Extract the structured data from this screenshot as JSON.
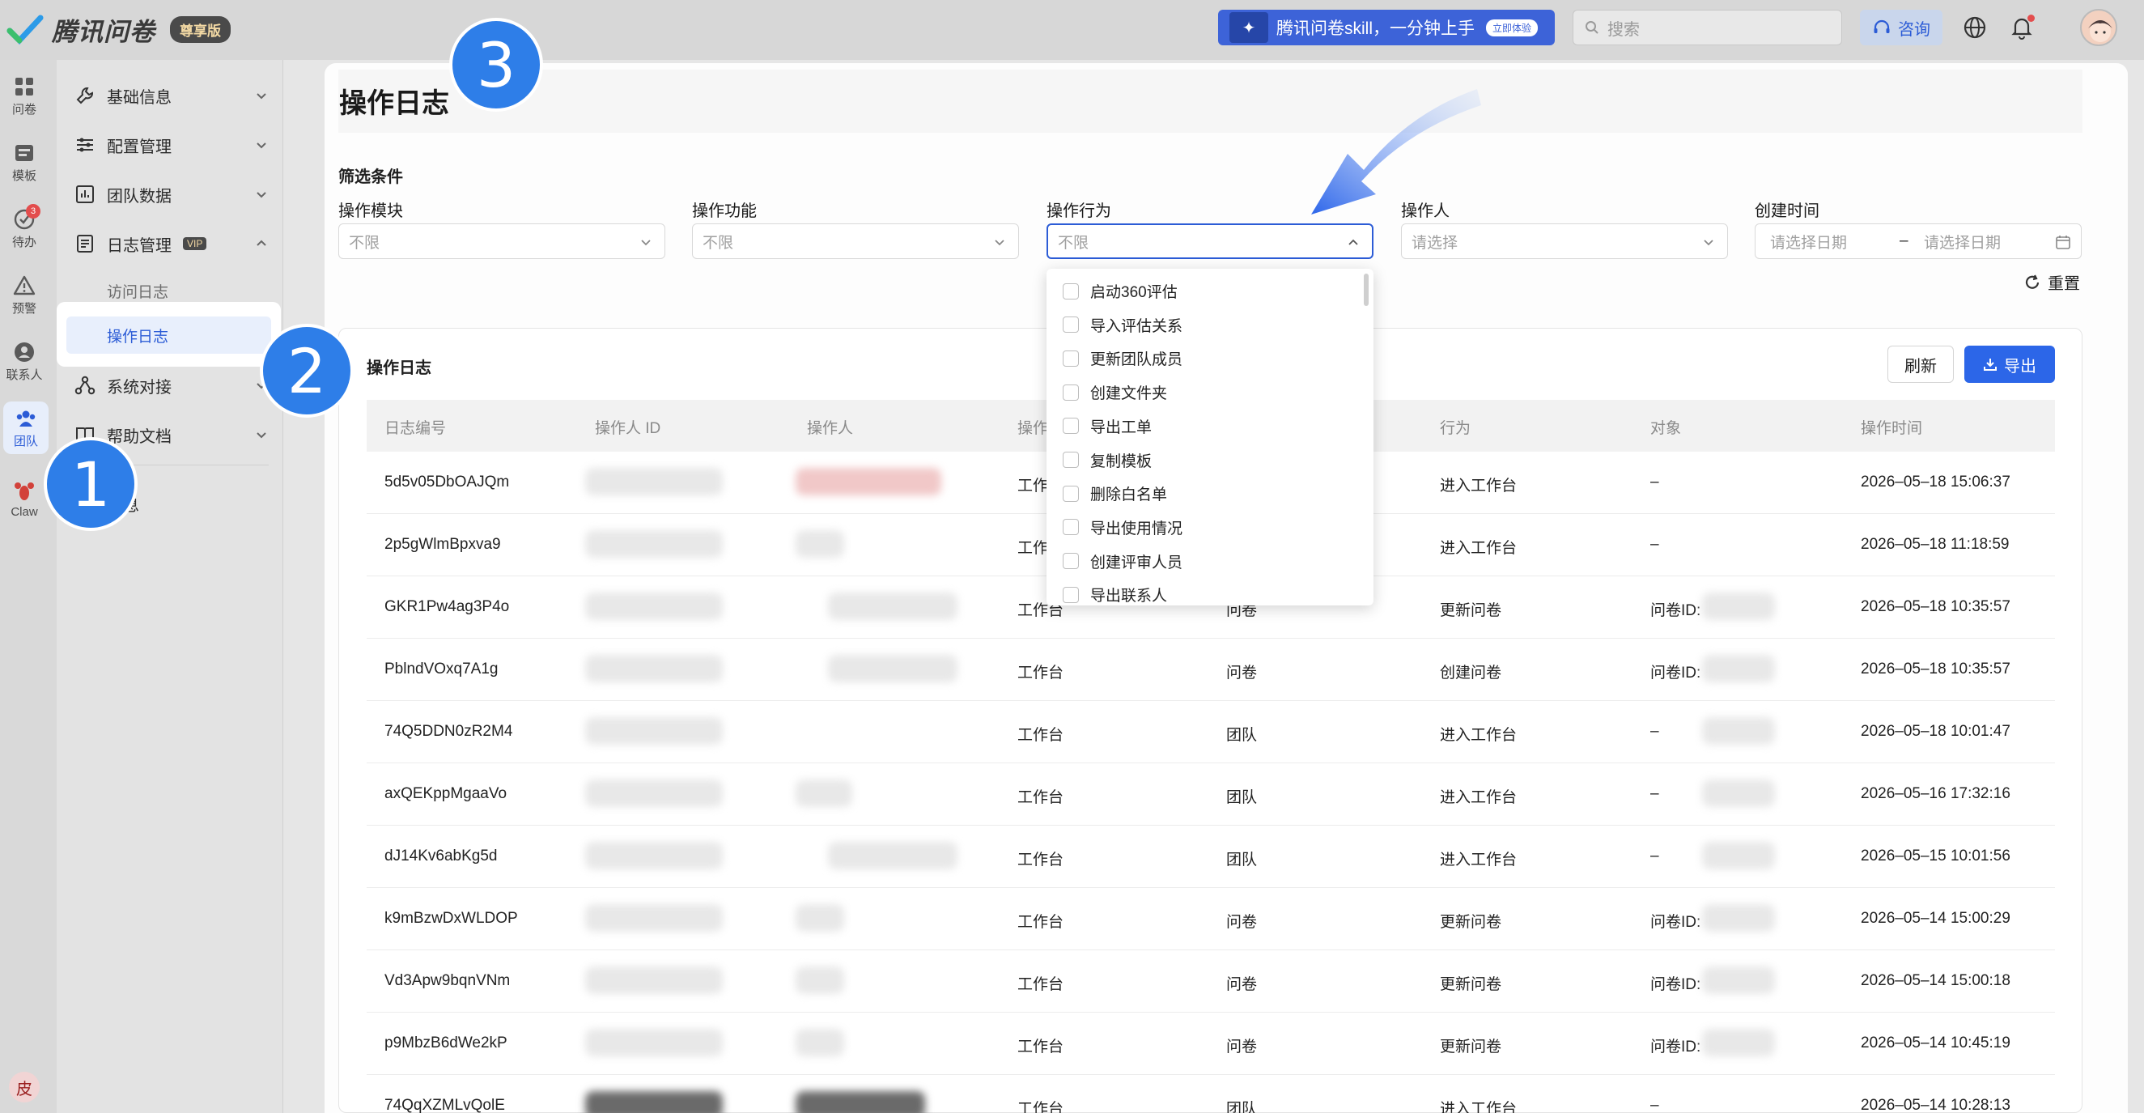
{
  "header": {
    "app_name": "腾讯问卷",
    "edition": "尊享版",
    "promo_text": "腾讯问卷skill，一分钟上手",
    "promo_chip": "立即体验",
    "search_placeholder": "搜索",
    "consult_label": "咨询"
  },
  "rail": {
    "items": [
      {
        "label": "问卷"
      },
      {
        "label": "模板"
      },
      {
        "label": "待办",
        "badge": "3"
      },
      {
        "label": "预警"
      },
      {
        "label": "联系人"
      },
      {
        "label": "团队"
      },
      {
        "label": "Claw"
      }
    ],
    "user_initial": "皮"
  },
  "sidenav": {
    "items": [
      {
        "label": "基础信息"
      },
      {
        "label": "配置管理"
      },
      {
        "label": "团队数据"
      },
      {
        "label": "日志管理",
        "tag": "VIP"
      },
      {
        "label": "系统对接"
      },
      {
        "label": "帮助文档"
      },
      {
        "label": "信息"
      }
    ],
    "sub_items": [
      "访问日志",
      "操作日志"
    ]
  },
  "page": {
    "title": "操作日志",
    "filters_title": "筛选条件",
    "filters": [
      {
        "label": "操作模块",
        "value": "不限"
      },
      {
        "label": "操作功能",
        "value": "不限"
      },
      {
        "label": "操作行为",
        "value": "不限"
      },
      {
        "label": "操作人",
        "value": "请选择"
      },
      {
        "label": "创建时间",
        "start": "请选择日期",
        "end": "请选择日期",
        "sep": "–"
      }
    ],
    "reset_label": "重置"
  },
  "log_card": {
    "title": "操作日志",
    "refresh_label": "刷新",
    "export_label": "导出",
    "columns": [
      "日志编号",
      "操作人 ID",
      "操作人",
      "操作",
      "",
      "行为",
      "对象",
      "操作时间"
    ],
    "rows": [
      {
        "id": "5d5v05DbOAJQm",
        "module": "工作台",
        "func": "",
        "action": "进入工作台",
        "object": "–",
        "time": "2026–05–18 15:06:37"
      },
      {
        "id": "2p5gWlmBpxva9",
        "module": "工作台",
        "func": "",
        "action": "进入工作台",
        "object": "–",
        "time": "2026–05–18 11:18:59"
      },
      {
        "id": "GKR1Pw4ag3P4o",
        "module": "工作台",
        "func": "问卷",
        "action": "更新问卷",
        "object": "问卷ID:",
        "time": "2026–05–18 10:35:57"
      },
      {
        "id": "PblndVOxq7A1g",
        "module": "工作台",
        "func": "问卷",
        "action": "创建问卷",
        "object": "问卷ID:",
        "time": "2026–05–18 10:35:57"
      },
      {
        "id": "74Q5DDN0zR2M4",
        "module": "工作台",
        "func": "团队",
        "action": "进入工作台",
        "object": "–",
        "time": "2026–05–18 10:01:47"
      },
      {
        "id": "axQEKppMgaaVo",
        "module": "工作台",
        "func": "团队",
        "action": "进入工作台",
        "object": "–",
        "time": "2026–05–16 17:32:16"
      },
      {
        "id": "dJ14Kv6abKg5d",
        "module": "工作台",
        "func": "团队",
        "action": "进入工作台",
        "object": "–",
        "time": "2026–05–15 10:01:56"
      },
      {
        "id": "k9mBzwDxWLDOP",
        "module": "工作台",
        "func": "问卷",
        "action": "更新问卷",
        "object": "问卷ID:",
        "time": "2026–05–14 15:00:29"
      },
      {
        "id": "Vd3Apw9bqnVNm",
        "module": "工作台",
        "func": "问卷",
        "action": "更新问卷",
        "object": "问卷ID:",
        "time": "2026–05–14 15:00:18"
      },
      {
        "id": "p9MbzB6dWe2kP",
        "module": "工作台",
        "func": "问卷",
        "action": "更新问卷",
        "object": "问卷ID:",
        "time": "2026–05–14 10:45:19"
      },
      {
        "id": "74QqXZMLvQolE",
        "module": "工作台",
        "func": "团队",
        "action": "进入工作台",
        "object": "–",
        "time": "2026–05–14 10:28:13"
      }
    ]
  },
  "dropdown": {
    "options": [
      "启动360评估",
      "导入评估关系",
      "更新团队成员",
      "创建文件夹",
      "导出工单",
      "复制模板",
      "删除白名单",
      "导出使用情况",
      "创建评审人员",
      "导出联系人"
    ]
  },
  "annotations": [
    "1",
    "2",
    "3"
  ],
  "colors": {
    "accent": "#2c66e8",
    "bubble": "#2e7ee8"
  }
}
